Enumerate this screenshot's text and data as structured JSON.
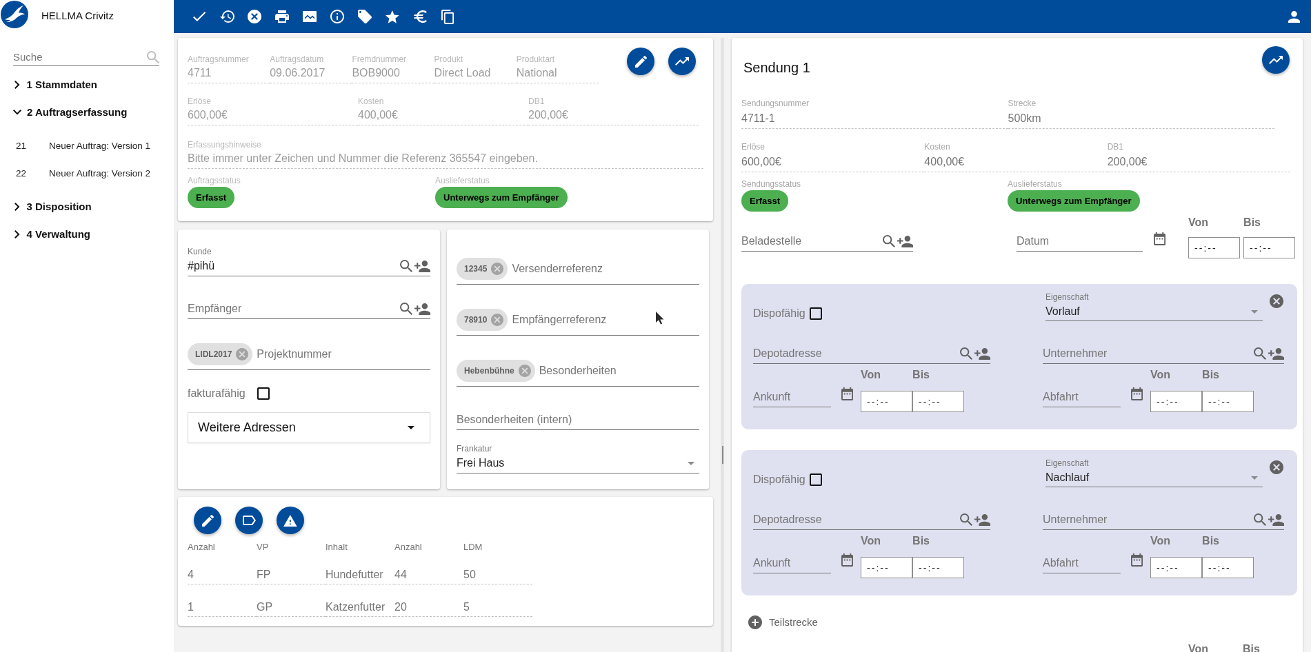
{
  "app": {
    "title": "HELLMA Crivitz"
  },
  "sidebar": {
    "search": {
      "placeholder": "Suche"
    },
    "items": [
      {
        "label": "1 Stammdaten",
        "expanded": false
      },
      {
        "label": "2 Auftragserfassung",
        "expanded": true,
        "children": [
          {
            "number": "21",
            "label": "Neuer Auftrag: Version 1"
          },
          {
            "number": "22",
            "label": "Neuer Auftrag: Version 2"
          }
        ]
      },
      {
        "label": "3 Disposition",
        "expanded": false
      },
      {
        "label": "4 Verwaltung",
        "expanded": false
      }
    ]
  },
  "order": {
    "fields": [
      {
        "label": "Auftragsnummer",
        "value": "4711"
      },
      {
        "label": "Auftragsdatum",
        "value": "09.06.2017"
      },
      {
        "label": "Fremdnummer",
        "value": "BOB9000"
      },
      {
        "label": "Produkt",
        "value": "Direct Load"
      },
      {
        "label": "Produktart",
        "value": "National"
      }
    ],
    "finance": [
      {
        "label": "Erlöse",
        "value": "600,00€"
      },
      {
        "label": "Kosten",
        "value": "400,00€"
      },
      {
        "label": "DB1",
        "value": "200,00€"
      }
    ],
    "note": {
      "label": "Erfassungshinweise",
      "value": "Bitte immer unter Zeichen und Nummer die Referenz 365547 eingeben."
    },
    "statuses": [
      {
        "label": "Auftragsstatus",
        "value": "Erfasst"
      },
      {
        "label": "Auslieferstatus",
        "value": "Unterwegs zum Empfänger"
      }
    ]
  },
  "parties": {
    "customer": {
      "label": "Kunde",
      "value": "#pihü"
    },
    "recipient": {
      "placeholder": "Empfänger"
    },
    "project": {
      "tags": [
        "LIDL2017"
      ],
      "placeholder": "Projektnummer"
    },
    "invoiceable": {
      "label": "fakturafähig",
      "checked": false
    },
    "more_addresses": {
      "label": "Weitere Adressen"
    }
  },
  "references": {
    "fields": [
      {
        "tags": [
          "12345"
        ],
        "placeholder": "Versenderreferenz"
      },
      {
        "tags": [
          "78910"
        ],
        "placeholder": "Empfängerreferenz"
      },
      {
        "tags": [
          "Hebenbühne"
        ],
        "placeholder": "Besonderheiten"
      },
      {
        "placeholder": "Besonderheiten (intern)"
      }
    ],
    "franking": {
      "label": "Frankatur",
      "value": "Frei Haus"
    }
  },
  "items": {
    "columns": [
      "Anzahl",
      "VP",
      "Inhalt",
      "Anzahl",
      "LDM"
    ],
    "rows": [
      [
        "4",
        "FP",
        "Hundefutter",
        "44",
        "50"
      ],
      [
        "1",
        "GP",
        "Katzenfutter",
        "20",
        "5"
      ]
    ]
  },
  "shipment": {
    "title": "Sendung 1",
    "fields": [
      {
        "label": "Sendungsnummer",
        "value": "4711-1"
      },
      {
        "label": "Strecke",
        "value": "500km"
      }
    ],
    "finance": [
      {
        "label": "Erlöse",
        "value": "600,00€"
      },
      {
        "label": "Kosten",
        "value": "400,00€"
      },
      {
        "label": "DB1",
        "value": "200,00€"
      }
    ],
    "statuses": [
      {
        "label": "Sendungsstatus",
        "value": "Erfasst"
      },
      {
        "label": "Auslieferstatus",
        "value": "Unterwegs zum Empfänger"
      }
    ],
    "loading": {
      "place": {
        "placeholder": "Beladestelle"
      },
      "date": {
        "placeholder": "Datum"
      },
      "times": [
        {
          "label": "Von",
          "placeholder": "--:--"
        },
        {
          "label": "Bis",
          "placeholder": "--:--"
        }
      ]
    },
    "legs": [
      {
        "dispo": {
          "label": "Dispofähig",
          "checked": false
        },
        "property": {
          "label": "Eigenschaft",
          "value": "Vorlauf"
        },
        "depot": {
          "placeholder": "Depotadresse"
        },
        "contractor": {
          "placeholder": "Unternehmer"
        },
        "arrival": {
          "placeholder": "Ankunft",
          "times": [
            {
              "label": "Von",
              "placeholder": "--:--"
            },
            {
              "label": "Bis",
              "placeholder": "--:--"
            }
          ]
        },
        "departure": {
          "placeholder": "Abfahrt",
          "times": [
            {
              "label": "Von",
              "placeholder": "--:--"
            },
            {
              "label": "Bis",
              "placeholder": "--:--"
            }
          ]
        }
      },
      {
        "dispo": {
          "label": "Dispofähig",
          "checked": false
        },
        "property": {
          "label": "Eigenschaft",
          "value": "Nachlauf"
        },
        "depot": {
          "placeholder": "Depotadresse"
        },
        "contractor": {
          "placeholder": "Unternehmer"
        },
        "arrival": {
          "placeholder": "Ankunft",
          "times": [
            {
              "label": "Von",
              "placeholder": "--:--"
            },
            {
              "label": "Bis",
              "placeholder": "--:--"
            }
          ]
        },
        "departure": {
          "placeholder": "Abfahrt",
          "times": [
            {
              "label": "Von",
              "placeholder": "--:--"
            },
            {
              "label": "Bis",
              "placeholder": "--:--"
            }
          ]
        }
      }
    ],
    "add_leg": {
      "label": "Teilstrecke"
    },
    "next_times": [
      {
        "label": "Von"
      },
      {
        "label": "Bis"
      }
    ]
  }
}
